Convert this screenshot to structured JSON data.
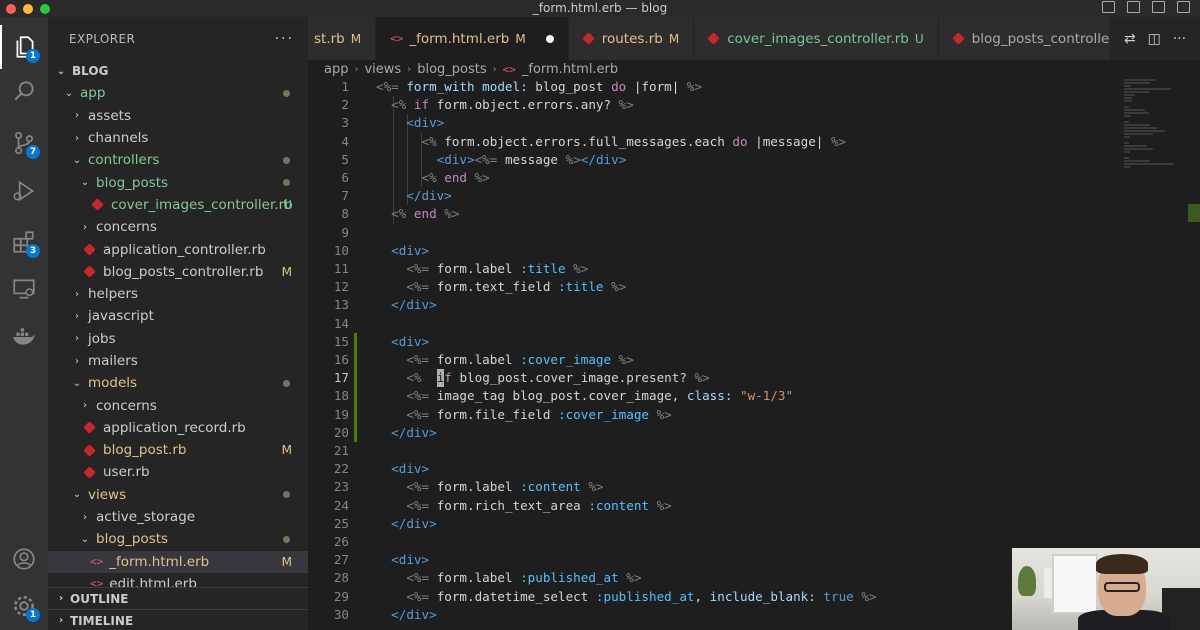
{
  "window": {
    "title": "_form.html.erb — blog"
  },
  "activity_bar": {
    "badges": {
      "explorer": "1",
      "source_control": "7",
      "extensions": "3",
      "settings": "1"
    }
  },
  "sidebar": {
    "title": "EXPLORER",
    "more": "···",
    "root": "BLOG",
    "items": [
      {
        "label": "app",
        "type": "folder-open",
        "indent": 0,
        "color": "green",
        "dot": true
      },
      {
        "label": "assets",
        "type": "folder",
        "indent": 1
      },
      {
        "label": "channels",
        "type": "folder",
        "indent": 1
      },
      {
        "label": "controllers",
        "type": "folder-open",
        "indent": 1,
        "color": "green",
        "dot": true
      },
      {
        "label": "blog_posts",
        "type": "folder-open",
        "indent": 2,
        "color": "green",
        "dot": true
      },
      {
        "label": "cover_images_controller.rb",
        "type": "ruby",
        "indent": 3,
        "color": "green",
        "status": "U"
      },
      {
        "label": "concerns",
        "type": "folder",
        "indent": 2
      },
      {
        "label": "application_controller.rb",
        "type": "ruby",
        "indent": 2
      },
      {
        "label": "blog_posts_controller.rb",
        "type": "ruby",
        "indent": 2,
        "status": "M"
      },
      {
        "label": "helpers",
        "type": "folder",
        "indent": 1
      },
      {
        "label": "javascript",
        "type": "folder",
        "indent": 1
      },
      {
        "label": "jobs",
        "type": "folder",
        "indent": 1
      },
      {
        "label": "mailers",
        "type": "folder",
        "indent": 1
      },
      {
        "label": "models",
        "type": "folder-open",
        "indent": 1,
        "color": "yellow",
        "dot": true
      },
      {
        "label": "concerns",
        "type": "folder",
        "indent": 2
      },
      {
        "label": "application_record.rb",
        "type": "ruby",
        "indent": 2
      },
      {
        "label": "blog_post.rb",
        "type": "ruby",
        "indent": 2,
        "color": "yellow",
        "status": "M"
      },
      {
        "label": "user.rb",
        "type": "ruby",
        "indent": 2
      },
      {
        "label": "views",
        "type": "folder-open",
        "indent": 1,
        "color": "yellow",
        "dot": true
      },
      {
        "label": "active_storage",
        "type": "folder",
        "indent": 2
      },
      {
        "label": "blog_posts",
        "type": "folder-open",
        "indent": 2,
        "color": "yellow",
        "dot": true
      },
      {
        "label": "_form.html.erb",
        "type": "erb",
        "indent": 3,
        "color": "yellow",
        "status": "M",
        "selected": true
      },
      {
        "label": "edit.html.erb",
        "type": "erb",
        "indent": 3
      }
    ],
    "outline": "OUTLINE",
    "timeline": "TIMELINE"
  },
  "tabs": [
    {
      "label": "st.rb",
      "status": "M",
      "icon": "none"
    },
    {
      "label": "_form.html.erb",
      "status": "M",
      "icon": "erb",
      "active": true,
      "dirty": true
    },
    {
      "label": "routes.rb",
      "status": "M",
      "icon": "ruby"
    },
    {
      "label": "cover_images_controller.rb",
      "status": "U",
      "icon": "ruby"
    },
    {
      "label": "blog_posts_controller.rb",
      "status": "",
      "icon": "ruby"
    }
  ],
  "breadcrumb": [
    "app",
    "views",
    "blog_posts",
    "_form.html.erb"
  ],
  "editor": {
    "current_line": 17,
    "lines": [
      [
        [
          "t-tag",
          "<%= "
        ],
        [
          "t-x",
          "form_with "
        ],
        [
          "t-x",
          "model: "
        ],
        [
          "t-p",
          "blog_post "
        ],
        [
          "t-k",
          "do "
        ],
        [
          "t-p",
          "|form| "
        ],
        [
          "t-tag",
          "%>"
        ]
      ],
      [
        [
          "t-p",
          "  "
        ],
        [
          "t-tag",
          "<% "
        ],
        [
          "t-k",
          "if "
        ],
        [
          "t-p",
          "form.object.errors.any? "
        ],
        [
          "t-tag",
          "%>"
        ]
      ],
      [
        [
          "t-p",
          "    "
        ],
        [
          "t-d",
          "<div>"
        ]
      ],
      [
        [
          "t-p",
          "      "
        ],
        [
          "t-tag",
          "<% "
        ],
        [
          "t-p",
          "form.object.errors.full_messages.each "
        ],
        [
          "t-k",
          "do "
        ],
        [
          "t-p",
          "|message| "
        ],
        [
          "t-tag",
          "%>"
        ]
      ],
      [
        [
          "t-p",
          "        "
        ],
        [
          "t-d",
          "<div>"
        ],
        [
          "t-tag",
          "<%= "
        ],
        [
          "t-p",
          "message "
        ],
        [
          "t-tag",
          "%>"
        ],
        [
          "t-d",
          "</div>"
        ]
      ],
      [
        [
          "t-p",
          "      "
        ],
        [
          "t-tag",
          "<% "
        ],
        [
          "t-k",
          "end "
        ],
        [
          "t-tag",
          "%>"
        ]
      ],
      [
        [
          "t-p",
          "    "
        ],
        [
          "t-d",
          "</div>"
        ]
      ],
      [
        [
          "t-p",
          "  "
        ],
        [
          "t-tag",
          "<% "
        ],
        [
          "t-k",
          "end "
        ],
        [
          "t-tag",
          "%>"
        ]
      ],
      [
        [
          "t-p",
          ""
        ]
      ],
      [
        [
          "t-p",
          "  "
        ],
        [
          "t-d",
          "<div>"
        ]
      ],
      [
        [
          "t-p",
          "    "
        ],
        [
          "t-tag",
          "<%= "
        ],
        [
          "t-p",
          "form.label "
        ],
        [
          "t-sym",
          ":title "
        ],
        [
          "t-tag",
          "%>"
        ]
      ],
      [
        [
          "t-p",
          "    "
        ],
        [
          "t-tag",
          "<%= "
        ],
        [
          "t-p",
          "form.text_field "
        ],
        [
          "t-sym",
          ":title "
        ],
        [
          "t-tag",
          "%>"
        ]
      ],
      [
        [
          "t-p",
          "  "
        ],
        [
          "t-d",
          "</div>"
        ]
      ],
      [
        [
          "t-p",
          ""
        ]
      ],
      [
        [
          "t-p",
          "  "
        ],
        [
          "t-d",
          "<div>"
        ]
      ],
      [
        [
          "t-p",
          "    "
        ],
        [
          "t-tag",
          "<%= "
        ],
        [
          "t-p",
          "form.label "
        ],
        [
          "t-sym",
          ":cover_image "
        ],
        [
          "t-tag",
          "%>"
        ]
      ],
      [
        [
          "t-p",
          "    "
        ],
        [
          "t-tag",
          "<%  "
        ],
        [
          "cursor",
          "i"
        ],
        [
          "t-k",
          "f "
        ],
        [
          "t-p",
          "blog_post.cover_image.present? "
        ],
        [
          "t-tag",
          "%>"
        ]
      ],
      [
        [
          "t-p",
          "    "
        ],
        [
          "t-tag",
          "<%= "
        ],
        [
          "t-p",
          "image_tag blog_post.cover_image, "
        ],
        [
          "t-x",
          "class: "
        ],
        [
          "t-s",
          "\"w-1/3\""
        ]
      ],
      [
        [
          "t-p",
          "    "
        ],
        [
          "t-tag",
          "<%= "
        ],
        [
          "t-p",
          "form.file_field "
        ],
        [
          "t-sym",
          ":cover_image "
        ],
        [
          "t-tag",
          "%>"
        ]
      ],
      [
        [
          "t-p",
          "  "
        ],
        [
          "t-d",
          "</div>"
        ]
      ],
      [
        [
          "t-p",
          ""
        ]
      ],
      [
        [
          "t-p",
          "  "
        ],
        [
          "t-d",
          "<div>"
        ]
      ],
      [
        [
          "t-p",
          "    "
        ],
        [
          "t-tag",
          "<%= "
        ],
        [
          "t-p",
          "form.label "
        ],
        [
          "t-sym",
          ":content "
        ],
        [
          "t-tag",
          "%>"
        ]
      ],
      [
        [
          "t-p",
          "    "
        ],
        [
          "t-tag",
          "<%= "
        ],
        [
          "t-p",
          "form.rich_text_area "
        ],
        [
          "t-sym",
          ":content "
        ],
        [
          "t-tag",
          "%>"
        ]
      ],
      [
        [
          "t-p",
          "  "
        ],
        [
          "t-d",
          "</div>"
        ]
      ],
      [
        [
          "t-p",
          ""
        ]
      ],
      [
        [
          "t-p",
          "  "
        ],
        [
          "t-d",
          "<div>"
        ]
      ],
      [
        [
          "t-p",
          "    "
        ],
        [
          "t-tag",
          "<%= "
        ],
        [
          "t-p",
          "form.label "
        ],
        [
          "t-sym",
          ":published_at "
        ],
        [
          "t-tag",
          "%>"
        ]
      ],
      [
        [
          "t-p",
          "    "
        ],
        [
          "t-tag",
          "<%= "
        ],
        [
          "t-p",
          "form.datetime_select "
        ],
        [
          "t-sym",
          ":published_at"
        ],
        [
          "t-p",
          ", "
        ],
        [
          "t-x",
          "include_blank: "
        ],
        [
          "t-d",
          "true "
        ],
        [
          "t-tag",
          "%>"
        ]
      ],
      [
        [
          "t-p",
          "  "
        ],
        [
          "t-d",
          "</div>"
        ]
      ]
    ]
  }
}
